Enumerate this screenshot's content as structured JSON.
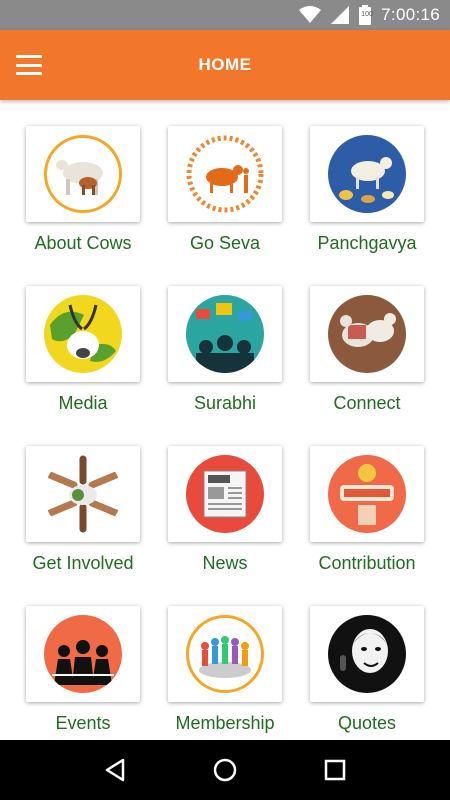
{
  "status_bar": {
    "time": "7:00:16",
    "battery_level": "100",
    "icons": [
      "wifi-icon",
      "signal-icon",
      "battery-icon"
    ]
  },
  "app_bar": {
    "title": "HOME",
    "menu_icon": "hamburger-menu-icon",
    "color": "#f2772a"
  },
  "menu": {
    "items": [
      {
        "label": "About Cows",
        "icon": "cow-icon"
      },
      {
        "label": "Go Seva",
        "icon": "sun-cow-icon"
      },
      {
        "label": "Panchgavya",
        "icon": "cow-products-icon"
      },
      {
        "label": "Media",
        "icon": "globe-cow-icon"
      },
      {
        "label": "Surabhi",
        "icon": "crowd-media-icon"
      },
      {
        "label": "Connect",
        "icon": "decorated-cows-icon"
      },
      {
        "label": "Get Involved",
        "icon": "hands-cow-icon"
      },
      {
        "label": "News",
        "icon": "newspaper-icon"
      },
      {
        "label": "Contribution",
        "icon": "donate-icon"
      },
      {
        "label": "Events",
        "icon": "people-events-icon"
      },
      {
        "label": "Membership",
        "icon": "members-circle-icon"
      },
      {
        "label": "Quotes",
        "icon": "portrait-quote-icon"
      }
    ]
  },
  "nav_bar": {
    "icons": [
      "back-icon",
      "home-icon",
      "recents-icon"
    ]
  },
  "colors": {
    "accent": "#f2772a",
    "label_green": "#1e6e1e",
    "status_bar": "#8a8a8a"
  }
}
